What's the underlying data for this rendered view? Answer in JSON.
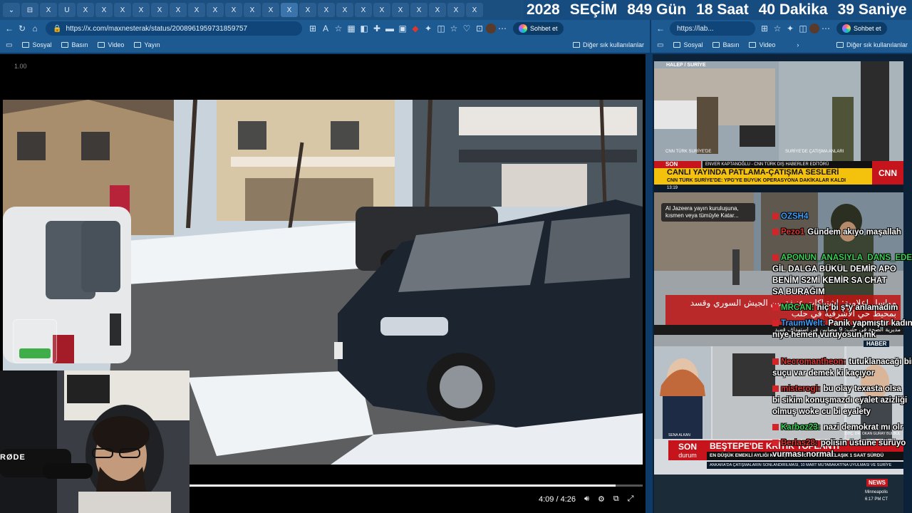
{
  "tabs": [
    "⌄",
    "⊟",
    "X",
    "U",
    "X",
    "X",
    "X",
    "X",
    "X",
    "X",
    "X",
    "X",
    "X",
    "X",
    "X",
    "X",
    "X",
    "X",
    "X",
    "X",
    "X",
    "X",
    "X",
    "X",
    "X",
    "X"
  ],
  "countdown": {
    "year": "2028",
    "year_label": "SEÇİM",
    "days": "849",
    "days_label": "Gün",
    "hours": "18",
    "hours_label": "Saat",
    "minutes": "40",
    "minutes_label": "Dakika",
    "seconds": "39",
    "seconds_label": "Saniye"
  },
  "left_browser": {
    "url": "https://x.com/maxnesterak/status/2008961959731859757",
    "chat_label": "Sohbet et",
    "bookmarks": [
      "Sosyal",
      "Basın",
      "Video",
      "Yayın"
    ],
    "other_bookmarks": "Diğer sık kullanılanlar"
  },
  "right_browser": {
    "url": "https://lab...",
    "chat_label": "Sohbet et",
    "bookmarks": [
      "Sosyal",
      "Basın",
      "Video"
    ],
    "other_bookmarks": "Diğer sık kullanılanlar"
  },
  "video": {
    "top_time": "1.00",
    "time": "4:09 / 4:26",
    "progress_fraction": 0.94
  },
  "webcam": {
    "brand": "RØDE"
  },
  "news1": {
    "location": "HALEP / SURİYE",
    "caption_left": "CNN TÜRK SURİYE'DE",
    "caption_right": "SURİYE'DE ÇATIŞMA ANLARI",
    "son_dakika": "SON DAKİKA",
    "reporter": "ENVER KAPTANOĞLU - CNN TÜRK DIŞ HABERLER EDİTÖRÜ",
    "headline": "CANLI YAYINDA PATLAMA-ÇATIŞMA SESLERİ",
    "subline": "CNN TÜRK SURİYE'DE: YPG'YE BÜYÜK OPERASYONA DAKİKALAR KALDI",
    "logo": "CNN",
    "time": "13:19"
  },
  "news2": {
    "popup": "Al Jazeera yayın kuruluşuna, kısmen veya tümüyle Katar...",
    "arabic": "مواسل إعلامية: اشتباكات عنيفة بين الجيش السوري وقسد بمحيط حي الأشرفية في حلب",
    "bottom": "مديرية الصحة في حلب: 9 مصابين في استهداف قسد"
  },
  "news3": {
    "anchor": "SENA ALKAN",
    "guest": "DOÇ. DR. OKAN GURAY BULBUL",
    "son": "SON",
    "durum": "durum",
    "headline": "BEŞTEPE'DE KRİTİK TOPLANTI",
    "subline": "EN DÜŞÜK EMEKLİ AYLIĞI KONUŞULDU TOPLANTI YAKLAŞIK 1 SAAT SÜRDÜ",
    "subline2": "ANKARA'DA ÇATIŞMALARIN SONLANDIRILMASI, 10 MART MUTABAKATI'NA UYULMASI VE SURİYE",
    "haber": "HABER"
  },
  "news4": {
    "brand": "NEWS",
    "time": "6:17 PM CT",
    "place": "Minneapolis"
  },
  "chat": [
    {
      "user": "OZSH4",
      "msg": "",
      "color": "#3aa0ff"
    },
    {
      "user": "Pezo1",
      "msg": "Gündem akıyo maşallah",
      "color": "#e0342f"
    },
    {
      "user": "APONUN_ANASIYLA_DANS_EDEN:",
      "msg": "",
      "color": "#39d353"
    },
    {
      "user": "",
      "msg": "GİL DALGA BÜKÜL DEMİR APO",
      "color": "#ffffff"
    },
    {
      "user": "",
      "msg": "BENİM S2Mİ KEMİR SA CHAT",
      "color": "#ffffff"
    },
    {
      "user": "",
      "msg": "SA BURAĞIM",
      "color": "#ffffff"
    },
    {
      "user": "MRCAN:",
      "msg": "hiç bi ş*y anlamadım",
      "color": "#39d353"
    },
    {
      "user": "TraumWelt:",
      "msg": "Panik yapmıştır kadın",
      "color": "#3aa0ff"
    },
    {
      "user": "",
      "msg": "niye hemen vuruyosun mk",
      "color": "#ffffff"
    },
    {
      "user": "Necromantheon:",
      "msg": "tutuklanacağı bir",
      "color": "#e0342f"
    },
    {
      "user": "",
      "msg": "suçu var demek ki kaçıyor",
      "color": "#ffffff"
    },
    {
      "user": "misterogi:",
      "msg": "bu olay texasta olsa",
      "color": "#e0342f"
    },
    {
      "user": "",
      "msg": "bi sikim konuşmazdı eyalet azizliği",
      "color": "#ffffff"
    },
    {
      "user": "",
      "msg": "olmuş woke cu bi eyalety",
      "color": "#ffffff"
    },
    {
      "user": "Karboz23:",
      "msg": "nazi demokrat mı olr",
      "color": "#39d353"
    },
    {
      "user": "Berlas28:",
      "msg": "polisin üstüne sürüyo",
      "color": "#e0342f"
    },
    {
      "user": "",
      "msg": "vurması normal",
      "color": "#ffffff"
    }
  ],
  "colors": {
    "frame": "#0d3a66",
    "tab": "#1b4f80",
    "accent_red": "#c5141b",
    "accent_yellow": "#f4c20d"
  }
}
